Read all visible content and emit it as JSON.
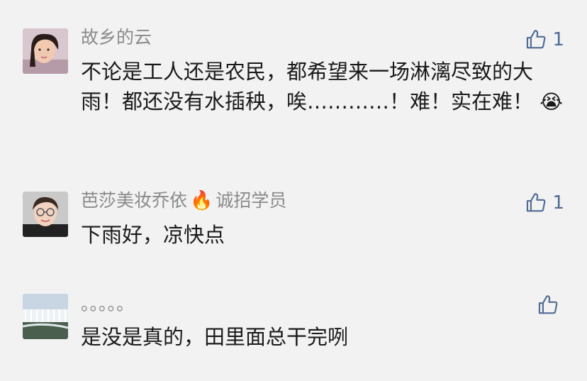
{
  "comments": [
    {
      "author": "故乡的云",
      "text": "不论是工人还是农民，都希望来一场淋漓尽致的大雨！都还没有水插秧，唉…………！难！实在难！",
      "emoji": "😭",
      "likes": "1"
    },
    {
      "author": "芭莎美妆乔依",
      "author_flame": "🔥",
      "author_suffix": "诚招学员",
      "text": "下雨好，凉快点",
      "likes": "1"
    },
    {
      "author": "。。。。。",
      "text": "是没是真的，田里面总干完咧",
      "likes": ""
    }
  ],
  "icons": {
    "like": "thumbs-up-outline-icon",
    "like_color": "#4f6b94"
  }
}
